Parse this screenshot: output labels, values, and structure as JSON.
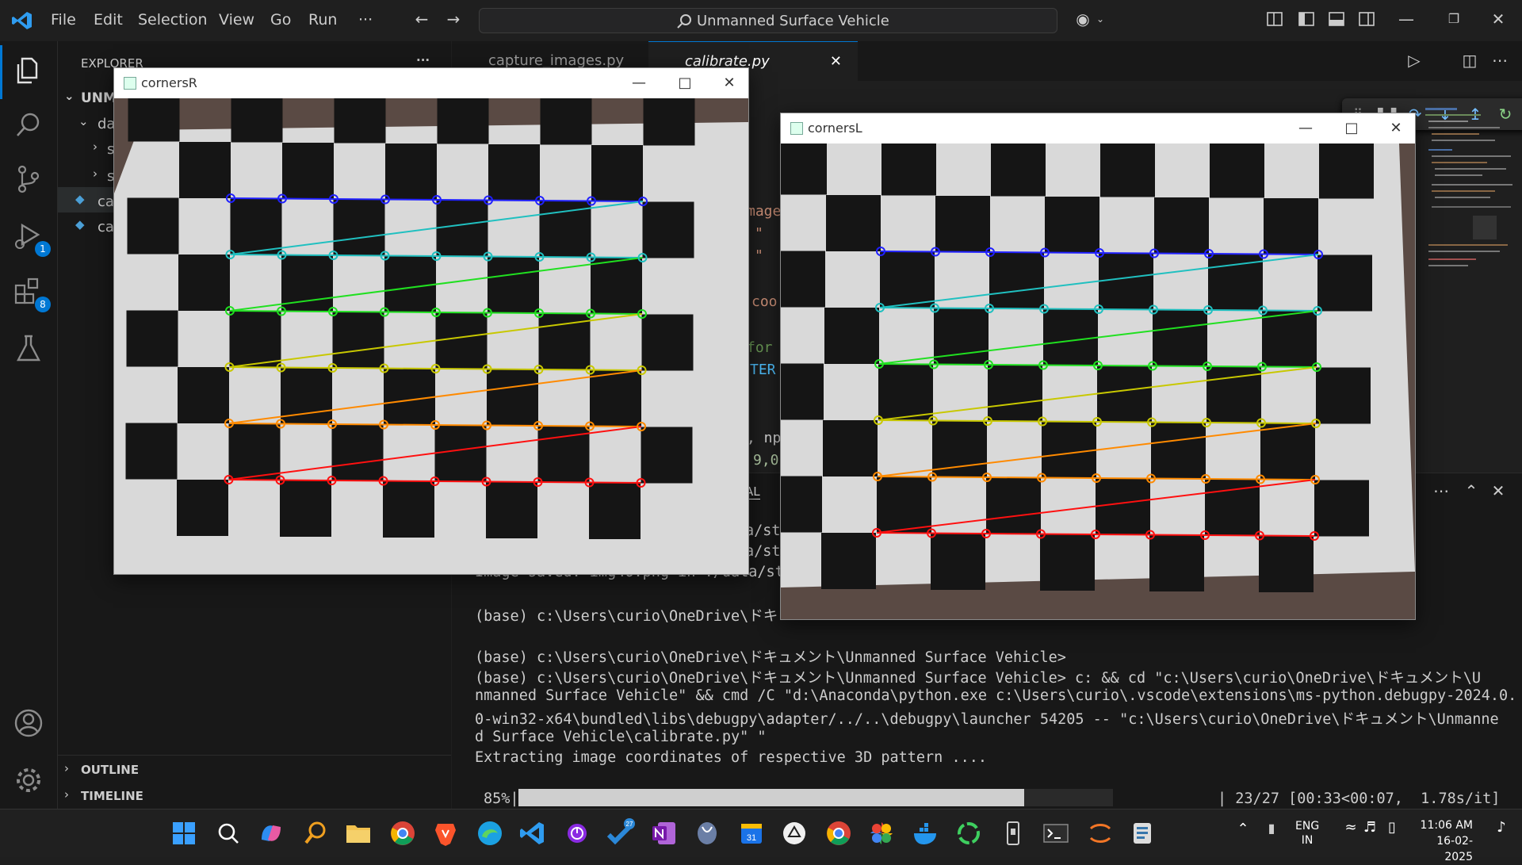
{
  "app": {
    "menu": [
      "File",
      "Edit",
      "Selection",
      "View",
      "Go",
      "Run",
      "···"
    ],
    "search_text": "Unmanned Surface Vehicle"
  },
  "activity": {
    "debug_badge": "1",
    "extensions_badge": "8"
  },
  "sidebar": {
    "header": "EXPLORER",
    "header_more": "···",
    "root_label": "UNM",
    "folder_label": "da",
    "sub1": "s",
    "sub2": "s",
    "file1": "ca",
    "file2": "ca",
    "outline": "OUTLINE",
    "timeline": "TIMELINE"
  },
  "editor": {
    "tabs": [
      "capture_images.py",
      "calibrate.py"
    ],
    "code_fragments": [
      "mage",
      "\"",
      "\"",
      "coo",
      "for",
      "TER",
      ", np",
      "9,0"
    ],
    "panel_tab_fragment": "AL"
  },
  "terminal": {
    "lines": [
      "a/st",
      "a/st",
      "Image saved: img46.png in ./data/st",
      "",
      "(base) c:\\Users\\curio\\OneDrive\\ドキ",
      "",
      "(base) c:\\Users\\curio\\OneDrive\\ドキュメント\\Unmanned Surface Vehicle>",
      "(base) c:\\Users\\curio\\OneDrive\\ドキュメント\\Unmanned Surface Vehicle> c: && cd \"c:\\Users\\curio\\OneDrive\\ドキュメント\\U",
      "nmanned Surface Vehicle\" && cmd /C \"d:\\Anaconda\\python.exe c:\\Users\\curio\\.vscode\\extensions\\ms-python.debugpy-2024.0.",
      "0-win32-x64\\bundled\\libs\\debugpy\\adapter/../..\\debugpy\\launcher 54205 -- \"c:\\Users\\curio\\OneDrive\\ドキュメント\\Unmanne",
      "d Surface Vehicle\\calibrate.py\" \"",
      "Extracting image coordinates of respective 3D pattern ...."
    ],
    "progress_percent_label": "85%|",
    "progress_fraction": 0.85,
    "progress_stats": "| 23/27 [00:33<00:07,  1.78s/it]"
  },
  "windows": {
    "right": {
      "title": "cornersR"
    },
    "left": {
      "title": "cornersL"
    }
  },
  "tray": {
    "lang1": "ENG",
    "lang2": "IN",
    "time": "11:06 AM",
    "date": "16-02-2025"
  },
  "colors": {
    "accent": "#0078d4",
    "rows": [
      "#2020ff",
      "#20c0c0",
      "#20e020",
      "#c8c800",
      "#ff8a00",
      "#ff1010"
    ]
  }
}
